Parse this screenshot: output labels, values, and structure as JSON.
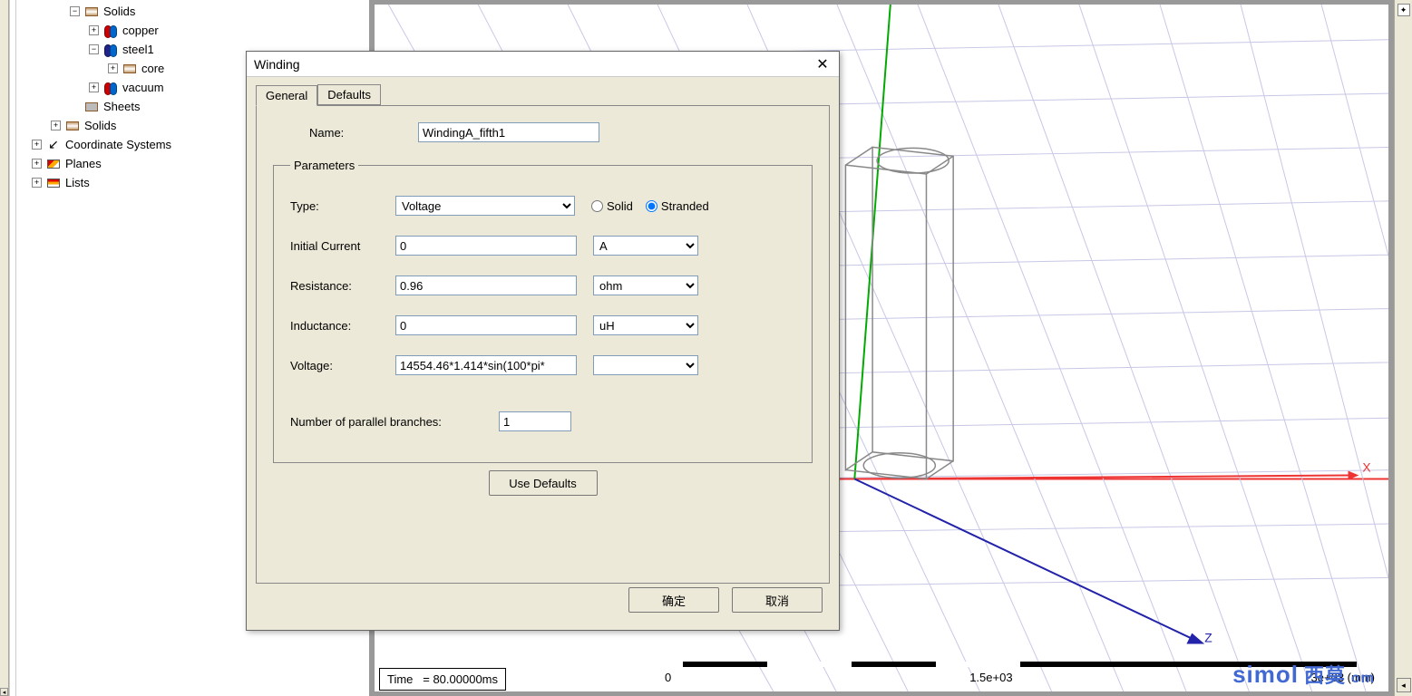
{
  "tree": {
    "solids_parent": "Solids",
    "copper": "copper",
    "steel1": "steel1",
    "core": "core",
    "vacuum": "vacuum",
    "sheets": "Sheets",
    "solids2": "Solids",
    "coord": "Coordinate Systems",
    "planes": "Planes",
    "lists": "Lists"
  },
  "dialog": {
    "title": "Winding",
    "tabs": {
      "general": "General",
      "defaults": "Defaults"
    },
    "name_label": "Name:",
    "name_value": "WindingA_fifth1",
    "params_legend": "Parameters",
    "type_label": "Type:",
    "type_value": "Voltage",
    "solid_label": "Solid",
    "stranded_label": "Stranded",
    "stranded_selected": true,
    "initcur_label": "Initial Current",
    "initcur_value": "0",
    "initcur_unit": "A",
    "res_label": "Resistance:",
    "res_value": "0.96",
    "res_unit": "ohm",
    "ind_label": "Inductance:",
    "ind_value": "0",
    "ind_unit": "uH",
    "volt_label": "Voltage:",
    "volt_value": "14554.46*1.414*sin(100*pi*",
    "volt_unit": "",
    "parallel_label": "Number of parallel branches:",
    "parallel_value": "1",
    "use_defaults": "Use Defaults",
    "ok": "确定",
    "cancel": "取消"
  },
  "viewport": {
    "time_label": "Time",
    "time_value": "= 80.00000ms",
    "axis_x": "X",
    "axis_z": "Z",
    "scale_0": "0",
    "scale_1": "1.5e+03",
    "scale_2": "3e+03 (mm)"
  },
  "watermark": {
    "lat": "simol",
    "cn": "西莫",
    "suffix": "om"
  }
}
